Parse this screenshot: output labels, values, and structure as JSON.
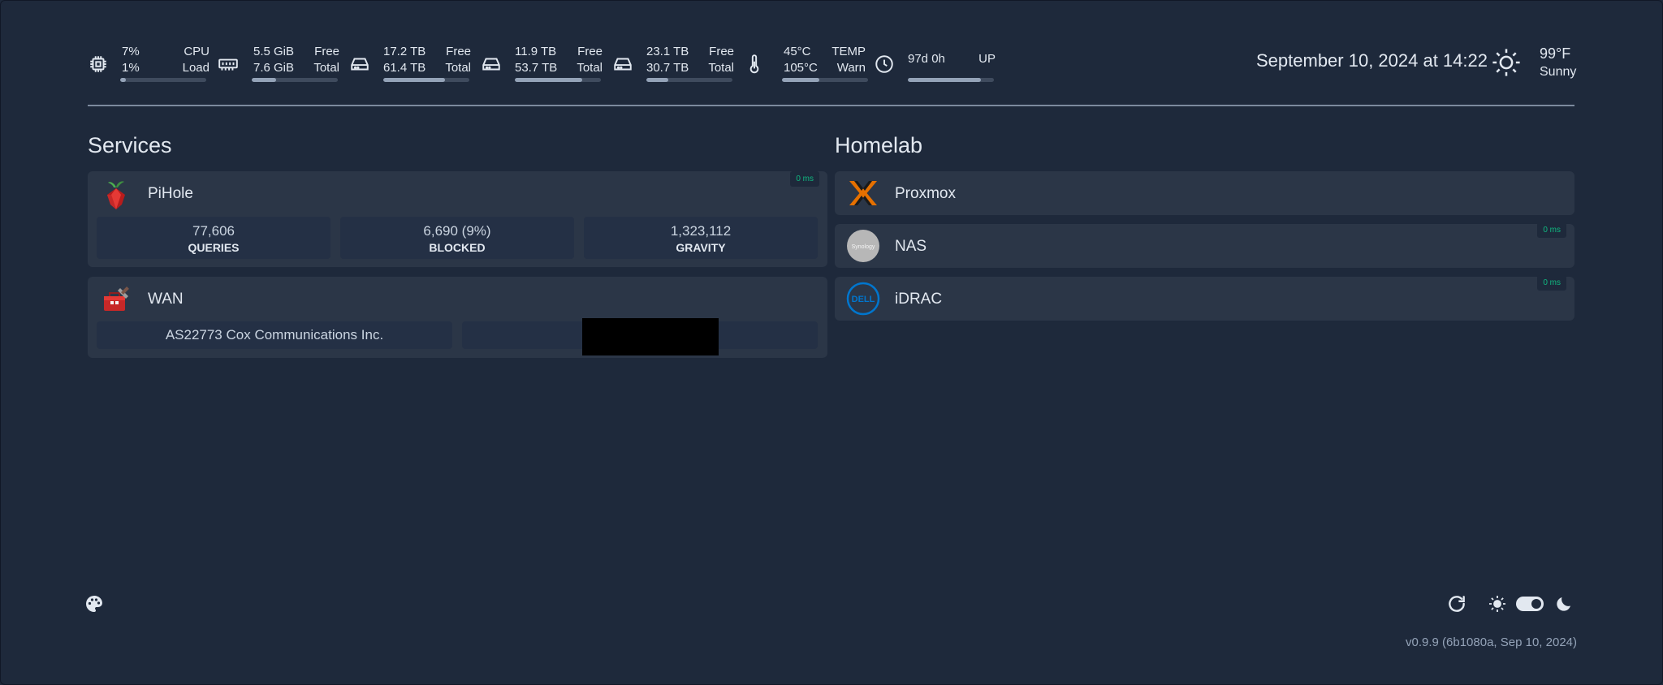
{
  "resources": [
    {
      "icon": "cpu-icon",
      "value1": "7%",
      "value2": "1%",
      "label1": "CPU",
      "label2": "Load",
      "fill": 0.07
    },
    {
      "icon": "memory-icon",
      "value1": "5.5 GiB",
      "value2": "7.6 GiB",
      "label1": "Free",
      "label2": "Total",
      "fill": 0.28
    },
    {
      "icon": "disk-icon",
      "value1": "17.2 TB",
      "value2": "61.4 TB",
      "label1": "Free",
      "label2": "Total",
      "fill": 0.72
    },
    {
      "icon": "disk-icon",
      "value1": "11.9 TB",
      "value2": "53.7 TB",
      "label1": "Free",
      "label2": "Total",
      "fill": 0.78
    },
    {
      "icon": "disk-icon",
      "value1": "23.1 TB",
      "value2": "30.7 TB",
      "label1": "Free",
      "label2": "Total",
      "fill": 0.25
    },
    {
      "icon": "thermometer-icon",
      "value1": "45°C",
      "value2": "105°C",
      "label1": "TEMP",
      "label2": "Warn",
      "fill": 0.43
    },
    {
      "icon": "clock-icon",
      "value1": "97d 0h",
      "value2": "",
      "label1": "UP",
      "label2": "",
      "fill": 0.85
    }
  ],
  "datetime": "September 10, 2024 at 14:22",
  "weather": {
    "temp": "99°F",
    "condition": "Sunny",
    "icon": "sun-icon"
  },
  "groups": {
    "services": {
      "title": "Services",
      "items": [
        {
          "name": "PiHole",
          "icon": "pihole-icon",
          "ping": "0 ms",
          "stats": [
            {
              "value": "77,606",
              "label": "QUERIES"
            },
            {
              "value": "6,690 (9%)",
              "label": "BLOCKED"
            },
            {
              "value": "1,323,112",
              "label": "GRAVITY"
            }
          ]
        },
        {
          "name": "WAN",
          "icon": "wan-toolbox-icon",
          "stats": [
            {
              "value": "AS22773 Cox Communications Inc."
            },
            {
              "value": ""
            }
          ]
        }
      ]
    },
    "homelab": {
      "title": "Homelab",
      "items": [
        {
          "name": "Proxmox",
          "icon": "proxmox-icon"
        },
        {
          "name": "NAS",
          "icon": "synology-icon",
          "ping": "0 ms",
          "logo_text": "Synology"
        },
        {
          "name": "iDRAC",
          "icon": "dell-icon",
          "ping": "0 ms",
          "logo_text": "DELL"
        }
      ]
    }
  },
  "footer": {
    "version": "v0.9.9 (6b1080a, Sep 10, 2024)"
  },
  "colors": {
    "background": "#1e293b",
    "card": "#2b3647",
    "ping": "#10b981"
  }
}
